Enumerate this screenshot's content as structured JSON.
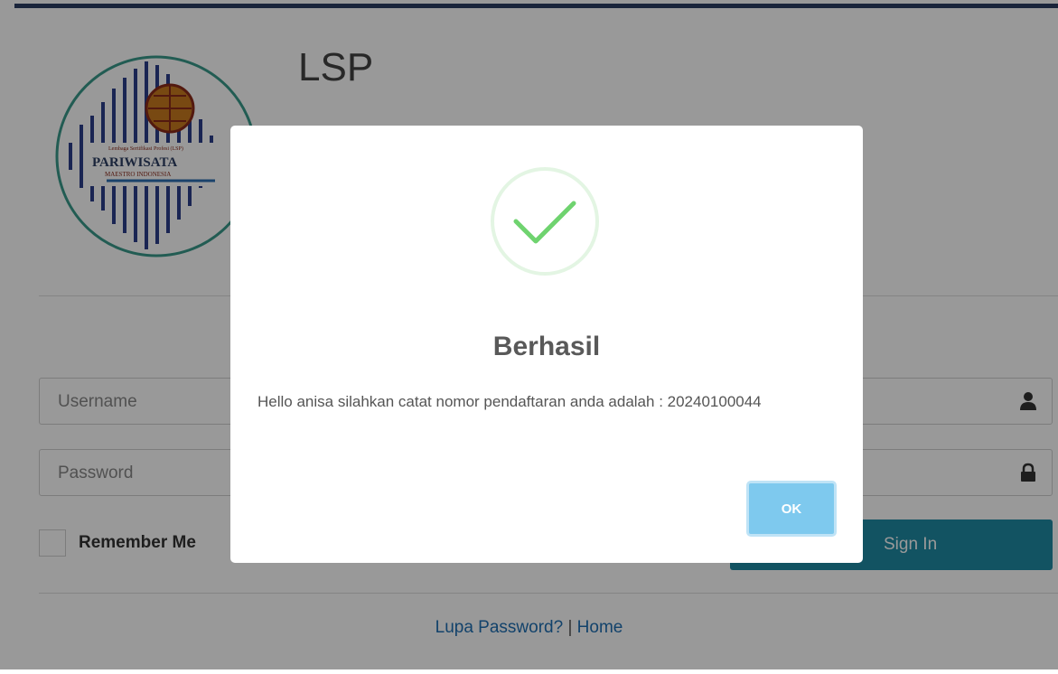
{
  "login": {
    "title": "LSP",
    "subtitle": "",
    "logo_text": "PARIWISATA",
    "logo_subtext": "MAESTRO INDONESIA",
    "logo_topline": "Lembaga Sertifikasi Profesi (LSP)",
    "username_placeholder": "Username",
    "password_placeholder": "Password",
    "remember_label": "Remember Me",
    "signin_label": "Sign In",
    "forgot_link": "Lupa Password?",
    "separator": "|",
    "home_link": "Home"
  },
  "dialog": {
    "title": "Berhasil",
    "message": "Hello anisa silahkan catat nomor pendaftaran anda adalah : 20240100044",
    "ok_label": "OK"
  },
  "colors": {
    "accent": "#1e8aa3",
    "success": "#6fd36f",
    "ok_button": "#7ec9ee"
  }
}
